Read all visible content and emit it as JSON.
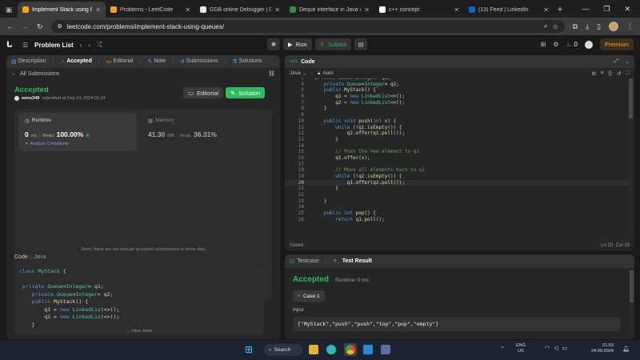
{
  "browser": {
    "tabs": [
      {
        "title": "Implement Stack using Qu",
        "color": "#ffa116",
        "active": true
      },
      {
        "title": "Problems - LeetCode",
        "color": "#ffa116",
        "active": false
      },
      {
        "title": "GDB online Debugger | Cr",
        "color": "#e5e5e5",
        "active": false
      },
      {
        "title": "Deque interface in Java wi",
        "color": "#2f8d46",
        "active": false
      },
      {
        "title": "c++ concept",
        "color": "#ffffff",
        "active": false
      },
      {
        "title": "(13) Feed | LinkedIn",
        "color": "#0a66c2",
        "active": false
      }
    ],
    "url": "leetcode.com/problems/implement-stack-using-queues/"
  },
  "lc_header": {
    "problem_list": "Problem List",
    "run": "Run",
    "submit": "Submit",
    "streak": "0",
    "premium": "Premium"
  },
  "left": {
    "tabs": [
      "Description",
      "Accepted",
      "Editorial",
      "Note",
      "Submissions",
      "Solutions"
    ],
    "all_submissions": "All Submissions",
    "status": "Accepted",
    "user": "sonu349",
    "submitted_at": "submitted at Sep 24, 2024 01:24",
    "editorial_btn": "Editorial",
    "solution_btn": "Solution",
    "runtime_label": "Runtime",
    "runtime_value": "0",
    "runtime_unit": "ms",
    "beats_label": "Beats",
    "runtime_beats": "100.00%",
    "analyze": "Analyze Complexity",
    "memory_label": "Memory",
    "memory_value": "41.30",
    "memory_unit": "MB",
    "memory_beats": "36.31%",
    "empty_msg": "Sorry, there are not enough accepted submissions to show data",
    "code_label": "Code",
    "code_lang": "Java",
    "view_more": "View more"
  },
  "code": {
    "title": "Code",
    "lang": "Java",
    "auto": "Auto",
    "saved": "Saved",
    "cursor": "Ln 20, Col 33"
  },
  "testcase": {
    "tab1": "Testcase",
    "tab2": "Test Result",
    "accepted": "Accepted",
    "runtime": "Runtime: 0 ms",
    "case": "Case 1",
    "input_label": "Input",
    "input_value": "[\"MyStack\",\"push\",\"push\",\"top\",\"pop\",\"empty\"]"
  },
  "taskbar": {
    "search": "Search",
    "lang": "ENG",
    "region": "US",
    "time": "01:53",
    "date": "24-09-2024"
  }
}
